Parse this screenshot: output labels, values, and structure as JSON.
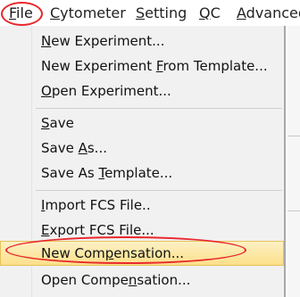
{
  "menubar": {
    "file": {
      "before": "",
      "key": "F",
      "after": "ile"
    },
    "cytometer": {
      "before": "",
      "key": "C",
      "after": "ytometer"
    },
    "setting": {
      "before": "",
      "key": "S",
      "after": "etting"
    },
    "qc": {
      "before": "",
      "key": "Q",
      "after": "C"
    },
    "advanced": {
      "before": "",
      "key": "A",
      "after": "dvanced"
    }
  },
  "file_menu": {
    "new_experiment": {
      "before": "",
      "key": "N",
      "after": "ew Experiment..."
    },
    "new_experiment_from_template": {
      "before": "New Experiment ",
      "key": "F",
      "after": "rom Template..."
    },
    "open_experiment": {
      "before": "",
      "key": "O",
      "after": "pen Experiment..."
    },
    "save": {
      "before": "",
      "key": "S",
      "after": "ave"
    },
    "save_as": {
      "before": "Save ",
      "key": "A",
      "after": "s..."
    },
    "save_as_template": {
      "before": "Save As ",
      "key": "T",
      "after": "emplate..."
    },
    "import_fcs": {
      "before": "",
      "key": "I",
      "after": "mport FCS File.."
    },
    "export_fcs": {
      "before": "",
      "key": "E",
      "after": "xport FCS File..."
    },
    "new_compensation": {
      "before": "New Com",
      "key": "p",
      "after": "ensation..."
    },
    "open_compensation": {
      "before": "Open Compe",
      "key": "n",
      "after": "sation..."
    }
  },
  "annotation_color": "#e8282c",
  "highlight_color": "#fbe08a"
}
